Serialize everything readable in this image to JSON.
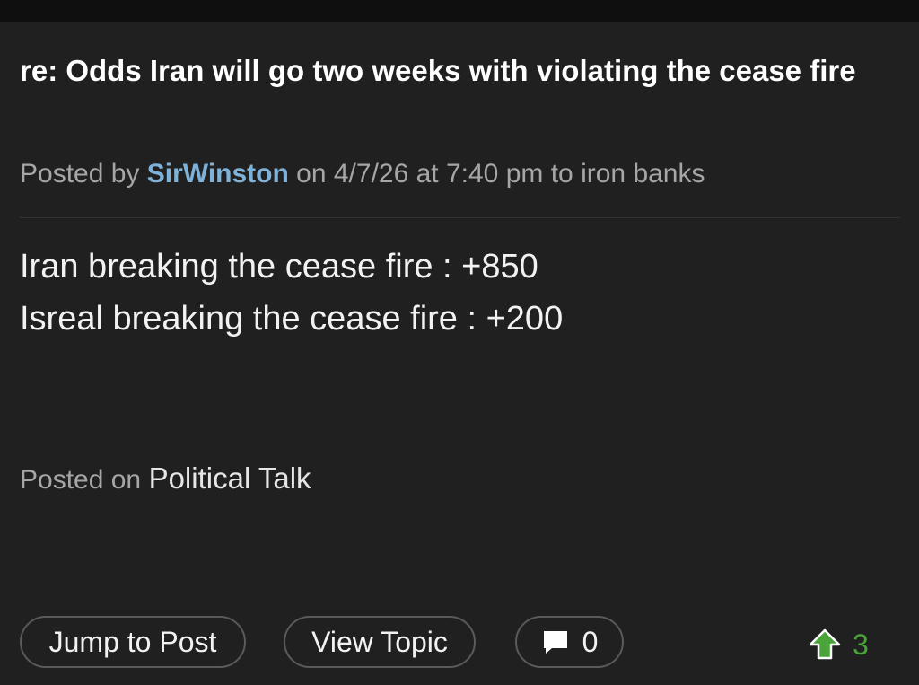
{
  "post": {
    "title": "re: Odds Iran will go two weeks with violating the cease fire",
    "meta": {
      "prefix": "Posted by",
      "author": "SirWinston",
      "middle": "on 4/7/26 at 7:40 pm to",
      "recipient": "iron banks"
    },
    "body": [
      "Iran breaking the cease fire : +850",
      "Isreal breaking the cease fire : +200"
    ],
    "posted_on": {
      "label": "Posted on",
      "forum": "Political Talk"
    }
  },
  "actions": {
    "jump_to_post": "Jump to Post",
    "view_topic": "View Topic",
    "comment_count": "0",
    "comment_icon": "speech-bubble-icon"
  },
  "vote": {
    "icon": "up-arrow-icon",
    "count": "3",
    "color": "#4aa43a"
  },
  "colors": {
    "background": "#202020",
    "top_bar": "#0f0f0f",
    "author_link": "#7fb2d8",
    "muted_text": "#a6a6a6"
  }
}
